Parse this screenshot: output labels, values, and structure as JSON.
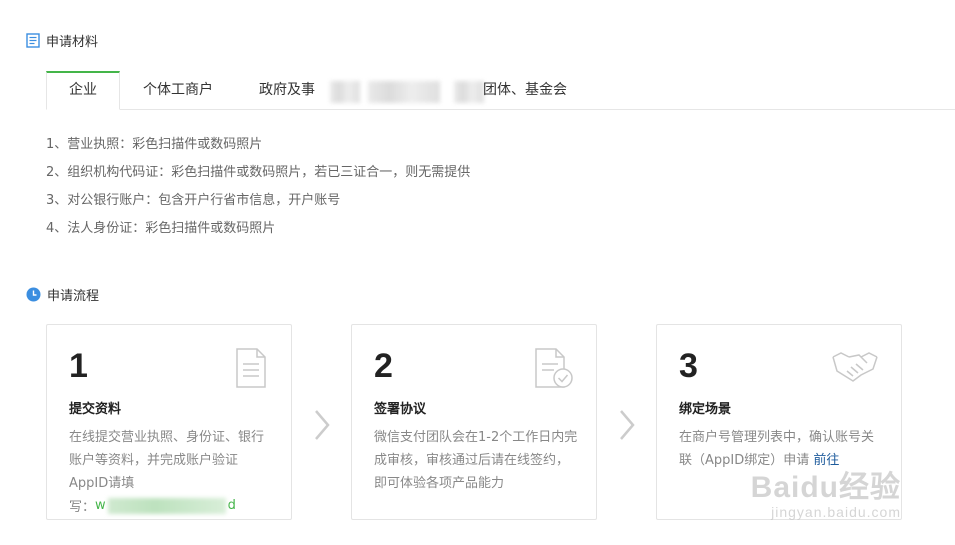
{
  "sections": {
    "materials_title": "申请材料",
    "process_title": "申请流程"
  },
  "tabs": [
    {
      "label": "企业"
    },
    {
      "label": "个体工商户"
    },
    {
      "label": "政府及事"
    },
    {
      "label": "团体、基金会"
    }
  ],
  "materials": [
    "1、营业执照：彩色扫描件或数码照片",
    "2、组织机构代码证：彩色扫描件或数码照片，若已三证合一，则无需提供",
    "3、对公银行账户：包含开户行省市信息，开户账号",
    "4、法人身份证：彩色扫描件或数码照片"
  ],
  "steps": [
    {
      "num": "1",
      "title": "提交资料",
      "desc": "在线提交营业执照、身份证、银行账户等资料，并完成账户验证 AppID请填",
      "extra_prefix": "写：",
      "extra_link_start": "w",
      "extra_link_end": "d",
      "icon": "document-icon"
    },
    {
      "num": "2",
      "title": "签署协议",
      "desc": "微信支付团队会在1-2个工作日内完成审核，审核通过后请在线签约，即可体验各项产品能力",
      "icon": "document-check-icon"
    },
    {
      "num": "3",
      "title": "绑定场景",
      "desc": "在商户号管理列表中，确认账号关联（AppID绑定）申请",
      "link": "前往",
      "icon": "handshake-icon"
    }
  ],
  "watermark": {
    "main": "Baidu经验",
    "sub": "jingyan.baidu.com"
  },
  "colors": {
    "accent_green": "#44b549",
    "link_blue": "#1e5b9c",
    "clock_blue": "#3b8ee0"
  }
}
